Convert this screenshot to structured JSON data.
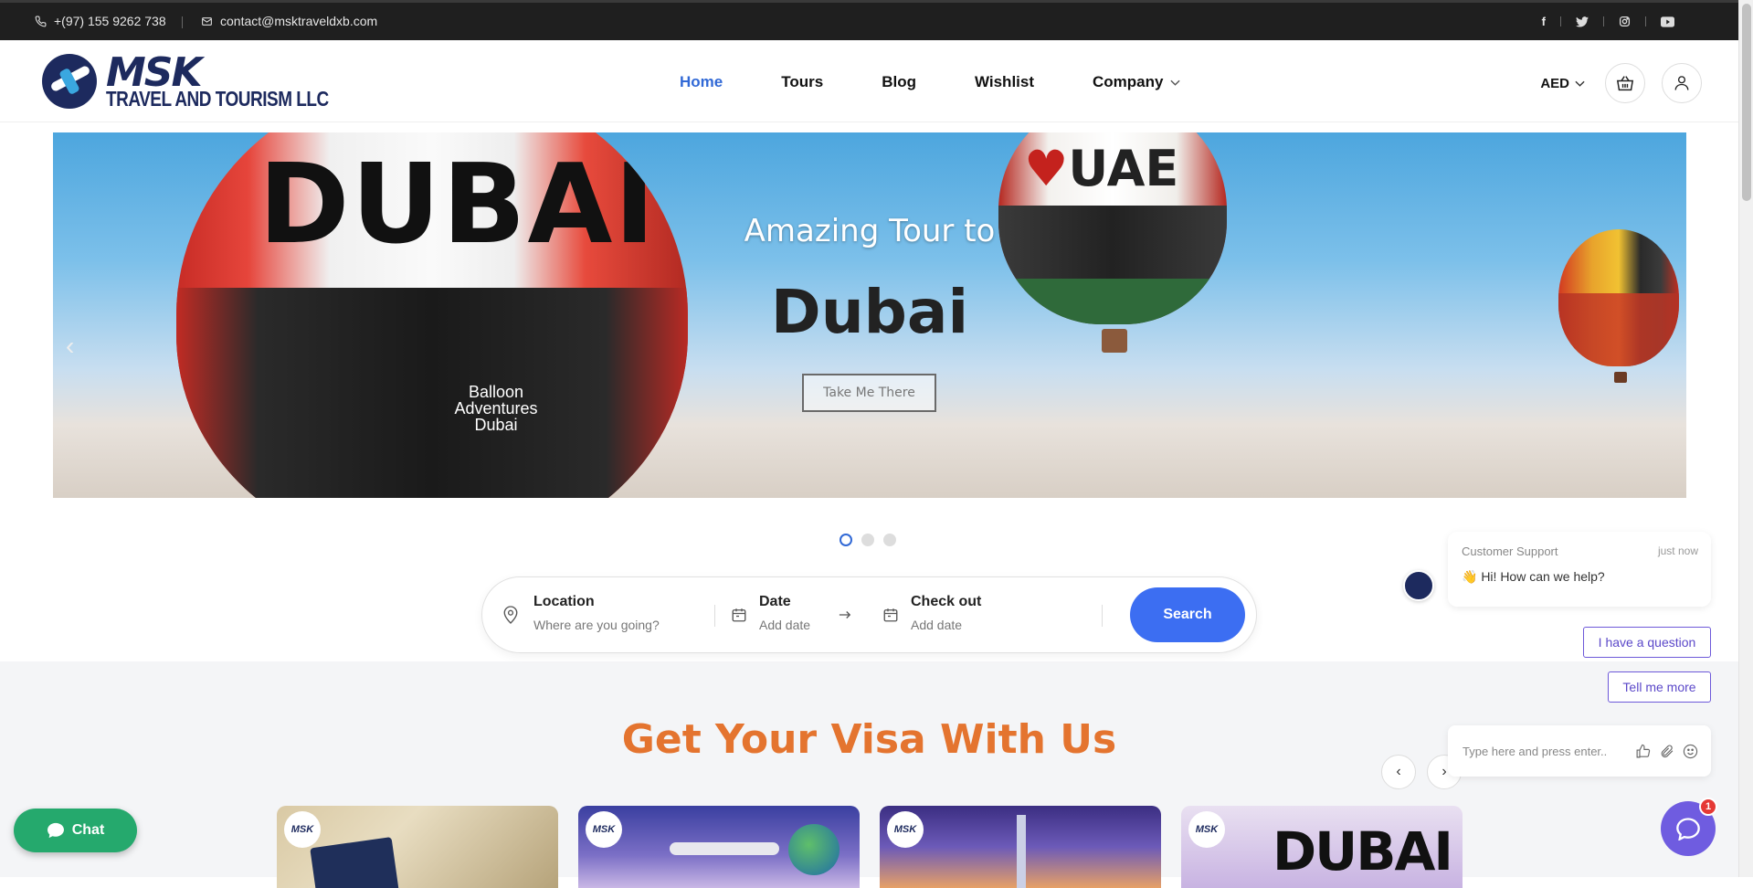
{
  "topbar": {
    "phone": "+(97) 155 9262 738",
    "email": "contact@msktraveldxb.com",
    "social": [
      "facebook-icon",
      "twitter-icon",
      "instagram-icon",
      "youtube-icon"
    ]
  },
  "logo": {
    "brand": "MSK",
    "tagline": "TRAVEL AND TOURISM LLC"
  },
  "nav": {
    "items": [
      "Home",
      "Tours",
      "Blog",
      "Wishlist",
      "Company"
    ],
    "active": "Home"
  },
  "header_right": {
    "currency": "AED"
  },
  "hero": {
    "subtitle": "Amazing Tour to",
    "title": "Dubai",
    "button": "Take Me There",
    "slide_count": 3,
    "active_slide": 1,
    "balloon_text_1": "DUBAI",
    "balloon_text_2": "UAE",
    "balloon_brand": "Balloon Adventures Dubai"
  },
  "search": {
    "location_label": "Location",
    "location_placeholder": "Where are you going?",
    "date_label": "Date",
    "date_placeholder": "Add date",
    "checkout_label": "Check out",
    "checkout_placeholder": "Add date",
    "button": "Search"
  },
  "visa": {
    "title": "Get Your Visa With Us",
    "card_badge": "MSK",
    "card4_text": "DUBAI"
  },
  "chat": {
    "float_label": "Chat",
    "agent_name": "Customer Support",
    "time": "just now",
    "message": "👋 Hi! How can we help?",
    "quick_replies": [
      "I have a question",
      "Tell me more"
    ],
    "input_placeholder": "Type here and press enter..",
    "unread": "1"
  },
  "colors": {
    "accent": "#3169d6",
    "search_button": "#3c6ef2",
    "visa_title": "#e4742f",
    "chat_green": "#25a96d",
    "launcher": "#6f5ce0"
  }
}
